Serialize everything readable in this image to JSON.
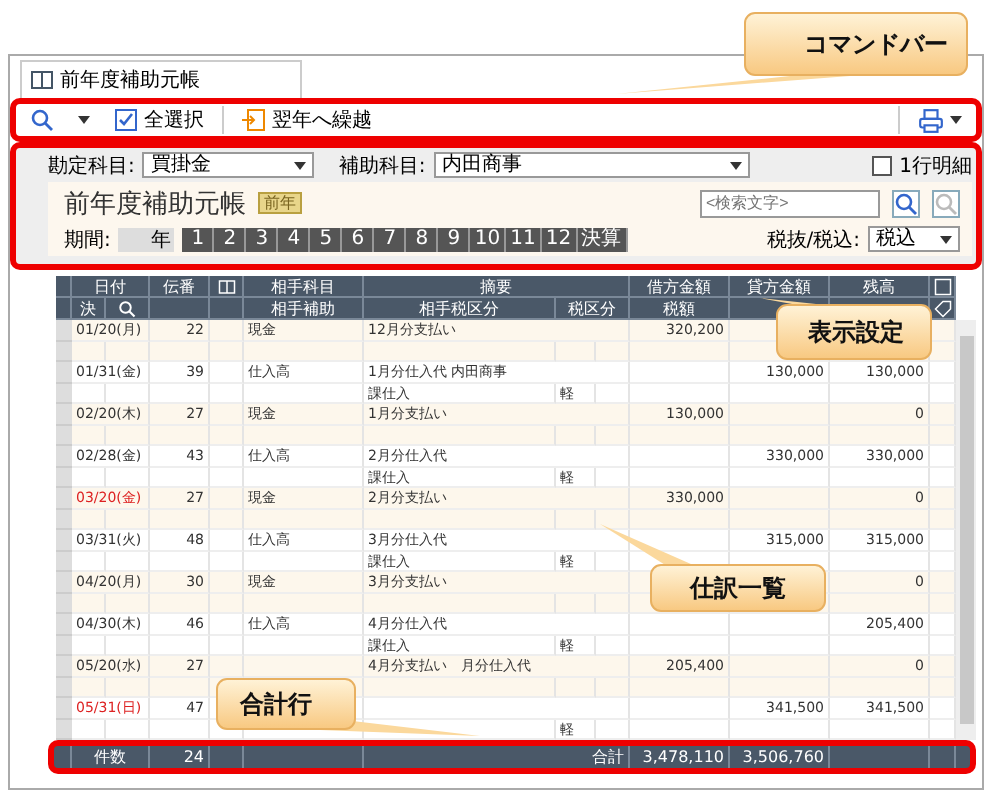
{
  "tab": {
    "label": "前年度補助元帳"
  },
  "command_bar": {
    "select_all": "全選択",
    "carry_over": "翌年へ繰越"
  },
  "settings": {
    "account_label": "勘定科目:",
    "account": "買掛金",
    "sub_account_label": "補助科目:",
    "sub_account": "内田商事",
    "detail_checkbox": {
      "label": "1行明細",
      "checked": false
    }
  },
  "header": {
    "title": "前年度補助元帳",
    "badge": "前年",
    "search": {
      "placeholder": "<検索文字>"
    },
    "period_label": "期間:",
    "year_suffix": "年",
    "months": [
      {
        "label": "1",
        "selected": false
      },
      {
        "label": "2",
        "selected": false
      },
      {
        "label": "3",
        "selected": false
      },
      {
        "label": "4",
        "selected": false
      },
      {
        "label": "5",
        "selected": false
      },
      {
        "label": "6",
        "selected": false
      },
      {
        "label": "7",
        "selected": false
      },
      {
        "label": "8",
        "selected": false
      },
      {
        "label": "9",
        "selected": false
      },
      {
        "label": "10",
        "selected": false
      },
      {
        "label": "11",
        "selected": false
      },
      {
        "label": "12",
        "selected": false
      },
      {
        "label": "決算",
        "selected": false
      }
    ],
    "tax_mode_label": "税抜/税込:",
    "tax_mode": "税込"
  },
  "table": {
    "columns_top": [
      "日付",
      "伝番",
      "相手科目",
      "摘要",
      "借方金額",
      "貸方金額",
      "残高"
    ],
    "columns_bottom": [
      "決",
      "相手補助",
      "相手税区分",
      "税区分",
      "税額"
    ],
    "rows": [
      {
        "date": "01/20(月)",
        "holiday": false,
        "no": "22",
        "account": "現金",
        "memo": "12月分支払い",
        "debit": "320,200"
      },
      {
        "date": "01/31(金)",
        "holiday": false,
        "no": "39",
        "account": "仕入高",
        "memo": "1月分仕入代 内田商事",
        "tax_type": "課仕入",
        "tax_flag": "軽",
        "credit": "130,000",
        "balance": "130,000"
      },
      {
        "date": "02/20(木)",
        "holiday": false,
        "no": "27",
        "account": "現金",
        "memo": "1月分支払い",
        "debit": "130,000",
        "balance": "0"
      },
      {
        "date": "02/28(金)",
        "holiday": false,
        "no": "43",
        "account": "仕入高",
        "memo": "2月分仕入代",
        "tax_type": "課仕入",
        "tax_flag": "軽",
        "credit": "330,000",
        "balance": "330,000"
      },
      {
        "date": "03/20(金)",
        "holiday": true,
        "no": "27",
        "account": "現金",
        "memo": "2月分支払い",
        "debit": "330,000",
        "balance": "0"
      },
      {
        "date": "03/31(火)",
        "holiday": false,
        "no": "48",
        "account": "仕入高",
        "memo": "3月分仕入代",
        "tax_type": "課仕入",
        "tax_flag": "軽",
        "credit": "315,000",
        "balance": "315,000"
      },
      {
        "date": "04/20(月)",
        "holiday": false,
        "no": "30",
        "account": "現金",
        "memo": "3月分支払い",
        "balance": "0"
      },
      {
        "date": "04/30(木)",
        "holiday": false,
        "no": "46",
        "account": "仕入高",
        "memo": "4月分仕入代",
        "tax_type": "課仕入",
        "tax_flag": "軽",
        "balance": "205,400"
      },
      {
        "date": "05/20(水)",
        "holiday": false,
        "no": "27",
        "memo": "4月分支払い　月分仕入代",
        "debit": "205,400",
        "balance": "0"
      },
      {
        "date": "05/31(日)",
        "holiday": true,
        "no": "47",
        "tax_flag": "軽",
        "credit": "341,500",
        "balance": "341,500"
      }
    ],
    "total": {
      "count_label": "件数",
      "count": "24",
      "sum_label": "合計",
      "debit": "3,478,110",
      "credit": "3,506,760"
    }
  },
  "callouts": [
    {
      "label": "コマンドバー"
    },
    {
      "label": "表示設定"
    },
    {
      "label": "仕訳一覧"
    },
    {
      "label": "合計行"
    }
  ]
}
